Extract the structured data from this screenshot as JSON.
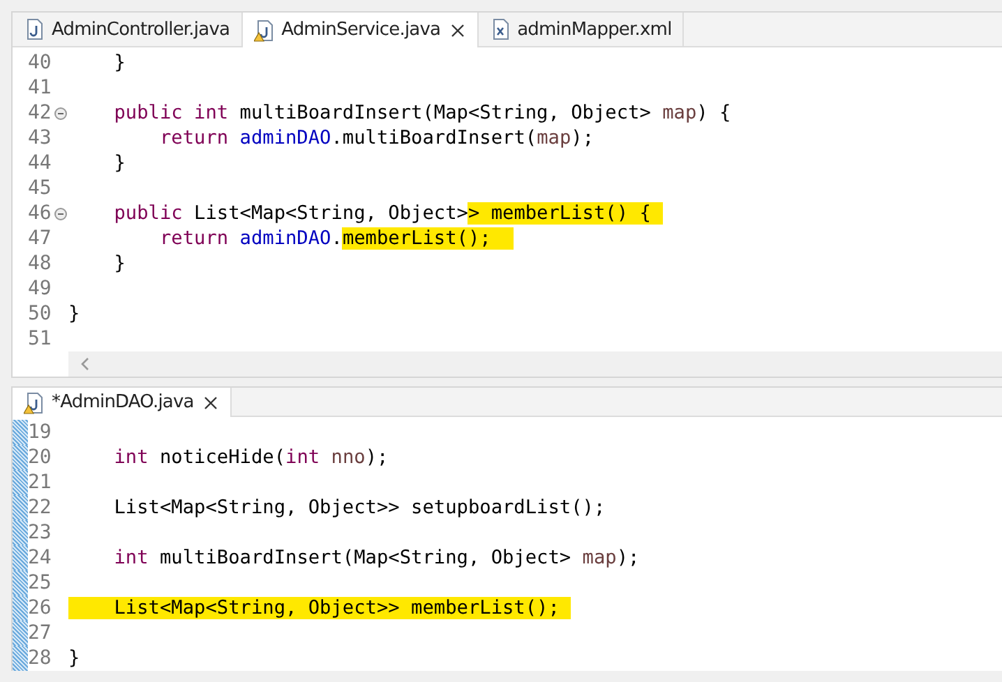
{
  "editors": [
    {
      "tabs": [
        {
          "label": "AdminController.java",
          "kind": "java",
          "warning": false,
          "selected": false
        },
        {
          "label": "AdminService.java",
          "kind": "java",
          "warning": true,
          "selected": true
        },
        {
          "label": "adminMapper.xml",
          "kind": "xml",
          "warning": false,
          "selected": false
        }
      ],
      "hscroll": true,
      "lines": [
        {
          "number": "40",
          "fold": false,
          "changed": false,
          "tokens": [
            {
              "text": "    }",
              "kind": "plain",
              "marked": false
            }
          ]
        },
        {
          "number": "41",
          "fold": false,
          "changed": false
        },
        {
          "number": "42",
          "fold": true,
          "changed": false,
          "tokens": [
            {
              "text": "    public int",
              "kind": "keyword",
              "marked": false
            },
            {
              "text": " multiBoardInsert(Map<String, Object> ",
              "kind": "plain",
              "marked": false
            },
            {
              "text": "map",
              "kind": "param",
              "marked": false
            },
            {
              "text": ") {",
              "kind": "plain",
              "marked": false
            }
          ]
        },
        {
          "number": "43",
          "fold": false,
          "changed": false,
          "tokens": [
            {
              "text": "        return",
              "kind": "keyword",
              "marked": false
            },
            {
              "text": " adminDAO",
              "kind": "field",
              "marked": false
            },
            {
              "text": ".multiBoardInsert(",
              "kind": "plain",
              "marked": false
            },
            {
              "text": "map",
              "kind": "param",
              "marked": false
            },
            {
              "text": ");",
              "kind": "plain",
              "marked": false
            }
          ]
        },
        {
          "number": "44",
          "fold": false,
          "changed": false,
          "tokens": [
            {
              "text": "    }",
              "kind": "plain",
              "marked": false
            }
          ]
        },
        {
          "number": "45",
          "fold": false,
          "changed": false
        },
        {
          "number": "46",
          "fold": true,
          "changed": false,
          "tokens": [
            {
              "text": "    public",
              "kind": "keyword",
              "marked": false
            },
            {
              "text": " List<Map<String, Object>",
              "kind": "plain",
              "marked": false
            },
            {
              "text": "> memberList() { ",
              "kind": "plain",
              "marked": true
            }
          ]
        },
        {
          "number": "47",
          "fold": false,
          "changed": false,
          "tokens": [
            {
              "text": "        return",
              "kind": "keyword",
              "marked": false
            },
            {
              "text": " adminDAO",
              "kind": "field",
              "marked": false
            },
            {
              "text": ".",
              "kind": "plain",
              "marked": false
            },
            {
              "text": "memberList();  ",
              "kind": "plain",
              "marked": true
            }
          ]
        },
        {
          "number": "48",
          "fold": false,
          "changed": false,
          "tokens": [
            {
              "text": "    }",
              "kind": "plain",
              "marked": false
            }
          ]
        },
        {
          "number": "49",
          "fold": false,
          "changed": false
        },
        {
          "number": "50",
          "fold": false,
          "changed": false,
          "tokens": [
            {
              "text": "}",
              "kind": "plain",
              "marked": false
            }
          ]
        },
        {
          "number": "51",
          "fold": false,
          "changed": false
        }
      ]
    },
    {
      "tabs": [
        {
          "label": "*AdminDAO.java",
          "kind": "java",
          "warning": true,
          "selected": true
        }
      ],
      "hscroll": false,
      "lines": [
        {
          "number": "19",
          "fold": false,
          "changed": true
        },
        {
          "number": "20",
          "fold": false,
          "changed": true,
          "tokens": [
            {
              "text": "    int",
              "kind": "keyword",
              "marked": false
            },
            {
              "text": " noticeHide(",
              "kind": "plain",
              "marked": false
            },
            {
              "text": "int",
              "kind": "keyword",
              "marked": false
            },
            {
              "text": " nno",
              "kind": "param",
              "marked": false
            },
            {
              "text": ");",
              "kind": "plain",
              "marked": false
            }
          ]
        },
        {
          "number": "21",
          "fold": false,
          "changed": true
        },
        {
          "number": "22",
          "fold": false,
          "changed": true,
          "tokens": [
            {
              "text": "    List<Map<String, Object>> setupboardList();",
              "kind": "plain",
              "marked": false
            }
          ]
        },
        {
          "number": "23",
          "fold": false,
          "changed": true
        },
        {
          "number": "24",
          "fold": false,
          "changed": true,
          "tokens": [
            {
              "text": "    int",
              "kind": "keyword",
              "marked": false
            },
            {
              "text": " multiBoardInsert(Map<String, Object> ",
              "kind": "plain",
              "marked": false
            },
            {
              "text": "map",
              "kind": "param",
              "marked": false
            },
            {
              "text": ");",
              "kind": "plain",
              "marked": false
            }
          ]
        },
        {
          "number": "25",
          "fold": false,
          "changed": true
        },
        {
          "number": "26",
          "fold": false,
          "changed": true,
          "tokens": [
            {
              "text": "    List<Map<String, Object>> memberList(); ",
              "kind": "plain",
              "marked": true
            }
          ]
        },
        {
          "number": "27",
          "fold": false,
          "changed": true
        },
        {
          "number": "28",
          "fold": false,
          "changed": true,
          "tokens": [
            {
              "text": "}",
              "kind": "plain",
              "marked": false
            }
          ]
        }
      ]
    }
  ]
}
